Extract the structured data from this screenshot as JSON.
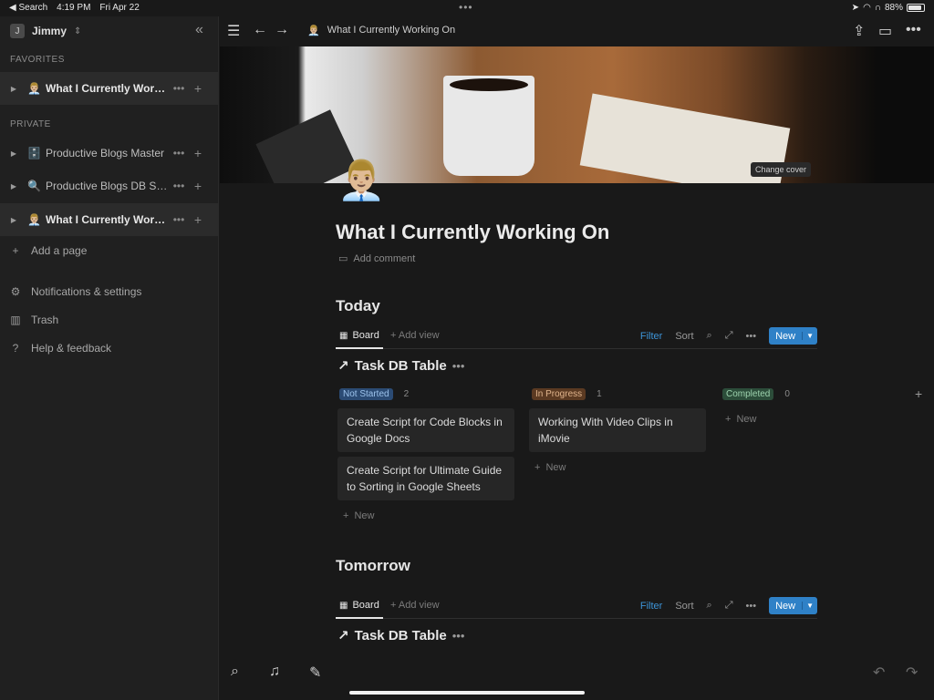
{
  "status_bar": {
    "back_label": "◀ Search",
    "time": "4:19 PM",
    "date": "Fri Apr 22",
    "multitask_dots": "•••",
    "battery": "88%",
    "battery_level": 0.88
  },
  "sidebar": {
    "workspace_initial": "J",
    "workspace_name": "Jimmy",
    "favorites_label": "FAVORITES",
    "favorites": [
      {
        "emoji": "👨🏼‍💼",
        "label": "What I Currently Working On"
      }
    ],
    "private_label": "PRIVATE",
    "private": [
      {
        "emoji": "🗄️",
        "label": "Productive Blogs Master"
      },
      {
        "emoji": "🔍",
        "label": "Productive Blogs DB Search"
      },
      {
        "emoji": "👨🏼‍💼",
        "label": "What I Currently Working On"
      }
    ],
    "add_page": "Add a page",
    "links": [
      {
        "icon": "gear-icon",
        "label": "Notifications & settings"
      },
      {
        "icon": "trash-icon",
        "label": "Trash"
      },
      {
        "icon": "help-icon",
        "label": "Help & feedback"
      }
    ]
  },
  "topbar": {
    "breadcrumb_emoji": "👨🏼‍💼",
    "breadcrumb": "What I Currently Working On"
  },
  "cover": {
    "change_cover": "Change cover"
  },
  "page": {
    "icon": "👨🏼‍💼",
    "title": "What I Currently Working On",
    "add_comment": "Add comment"
  },
  "sections": [
    {
      "heading": "Today",
      "view_tab": "Board",
      "add_view": "Add view",
      "filter": "Filter",
      "sort": "Sort",
      "new": "New",
      "db_title": "Task DB Table",
      "groups": [
        {
          "tag": "Not Started",
          "color": "#2b4b74",
          "text_color": "#9cc3ec",
          "count": "2",
          "cards": [
            "Create Script for Code Blocks in Google Docs",
            "Create Script for Ultimate Guide to Sorting in Google Sheets"
          ],
          "new": "New"
        },
        {
          "tag": "In Progress",
          "color": "#5b3a22",
          "text_color": "#e0b48c",
          "count": "1",
          "cards": [
            "Working With Video Clips in iMovie"
          ],
          "new": "New"
        },
        {
          "tag": "Completed",
          "color": "#2c4d3a",
          "text_color": "#9ed3ae",
          "count": "0",
          "cards": [],
          "new": "New"
        }
      ]
    },
    {
      "heading": "Tomorrow",
      "view_tab": "Board",
      "add_view": "Add view",
      "filter": "Filter",
      "sort": "Sort",
      "new": "New",
      "db_title": "Task DB Table"
    }
  ]
}
